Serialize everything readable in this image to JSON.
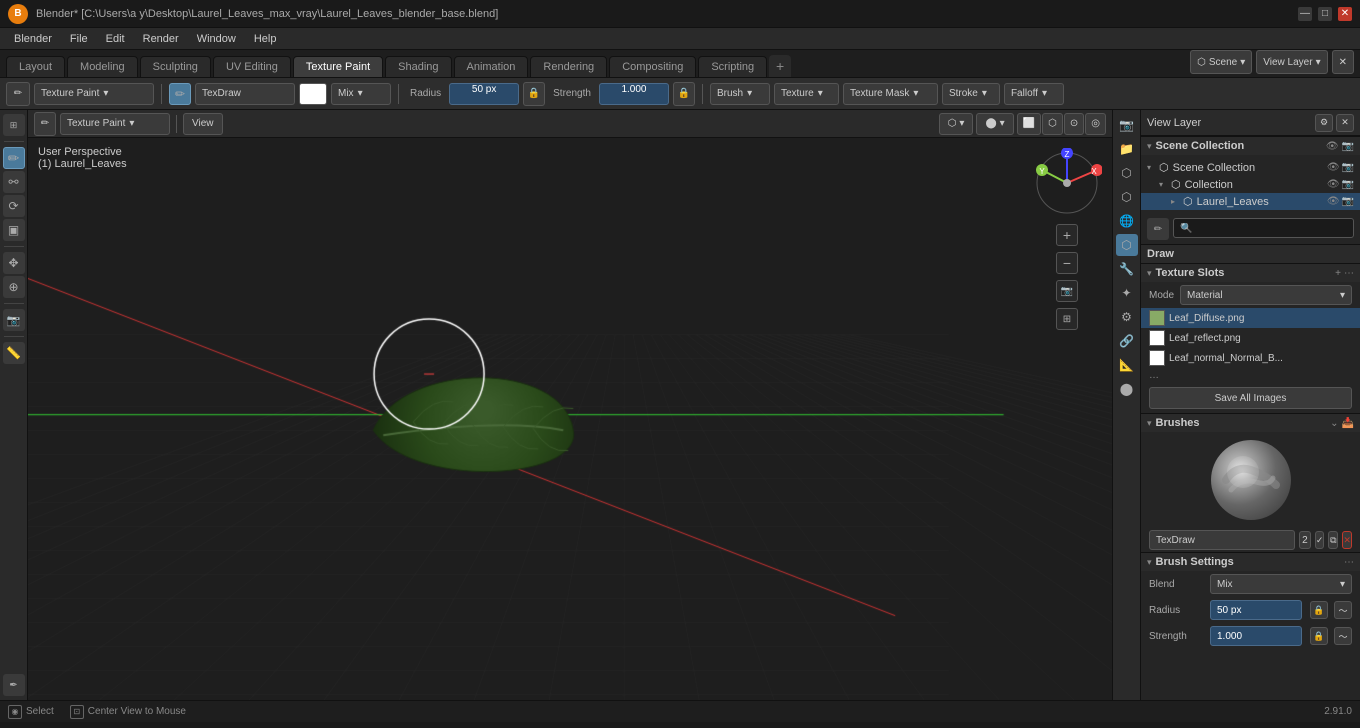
{
  "titlebar": {
    "title": "Blender* [C:\\Users\\a y\\Desktop\\Laurel_Leaves_max_vray\\Laurel_Leaves_blender_base.blend]",
    "logo": "B",
    "min_btn": "—",
    "max_btn": "□",
    "close_btn": "✕"
  },
  "menubar": {
    "items": [
      "Blender",
      "File",
      "Edit",
      "Render",
      "Window",
      "Help"
    ]
  },
  "workspace_tabs": {
    "tabs": [
      "Layout",
      "Modeling",
      "Sculpting",
      "UV Editing",
      "Texture Paint",
      "Shading",
      "Animation",
      "Rendering",
      "Compositing",
      "Scripting"
    ],
    "active": "Texture Paint",
    "add_label": "+"
  },
  "toolbar_top": {
    "mode_label": "Texture Paint",
    "brush_label": "TexDraw",
    "blend_label": "Mix",
    "radius_label": "Radius",
    "radius_value": "50 px",
    "strength_label": "Strength",
    "strength_value": "1.000",
    "brush_btn": "Brush",
    "texture_btn": "Texture",
    "texture_mask_btn": "Texture Mask",
    "stroke_btn": "Stroke",
    "falloff_btn": "Falloff"
  },
  "left_toolbar": {
    "tools": [
      {
        "name": "select",
        "icon": "✦",
        "tooltip": "Select"
      },
      {
        "name": "brush",
        "icon": "✏",
        "tooltip": "Brush",
        "active": true
      },
      {
        "name": "fill",
        "icon": "◉",
        "tooltip": "Fill"
      },
      {
        "name": "smear",
        "icon": "⟳",
        "tooltip": "Smear"
      },
      {
        "name": "clone",
        "icon": "⊕",
        "tooltip": "Clone"
      },
      {
        "name": "mask",
        "icon": "⬡",
        "tooltip": "Mask"
      }
    ]
  },
  "viewport": {
    "info_line1": "User Perspective",
    "info_line2": "(1) Laurel_Leaves"
  },
  "viewport_header": {
    "mode_btn": "Texture Paint",
    "view_btn": "View"
  },
  "right_icons": {
    "icons": [
      "⬡",
      "☰",
      "🔧",
      "⚙",
      "🌐",
      "💡",
      "🎨",
      "📐",
      "⬤",
      "⋯",
      "◎"
    ]
  },
  "right_panel": {
    "header_title": "View Layer",
    "close_btn": "✕",
    "search_placeholder": "🔍",
    "scene_collection": {
      "title": "Scene Collection",
      "items": [
        {
          "label": "Scene Collection",
          "indent": 0,
          "expanded": true,
          "icon": "📁"
        },
        {
          "label": "Collection",
          "indent": 1,
          "expanded": true,
          "icon": "📁"
        },
        {
          "label": "Laurel_Leaves",
          "indent": 2,
          "expanded": false,
          "icon": "🍃",
          "selected": true
        }
      ]
    },
    "properties": {
      "draw_label": "Draw",
      "texture_slots_title": "Texture Slots",
      "mode_label": "Mode",
      "mode_value": "Material",
      "textures": [
        {
          "name": "Leaf_Diffuse.png",
          "selected": true,
          "color": "#88aa66"
        },
        {
          "name": "Leaf_reflect.png",
          "selected": false,
          "color": "#ffffff"
        },
        {
          "name": "Leaf_normal_Normal_B...",
          "selected": false,
          "color": "#ffffff"
        }
      ],
      "save_all_label": "Save All Images",
      "brushes_title": "Brushes",
      "brush_name": "TexDraw",
      "brush_num": "2",
      "brush_settings_title": "Brush Settings",
      "blend_label": "Blend",
      "blend_value": "Mix",
      "radius_label": "Radius",
      "radius_value": "50 px",
      "strength_label": "Strength",
      "strength_value": "1.000"
    }
  },
  "statusbar": {
    "select_label": "Select",
    "center_view_label": "Center View to Mouse",
    "version": "2.91.0"
  }
}
